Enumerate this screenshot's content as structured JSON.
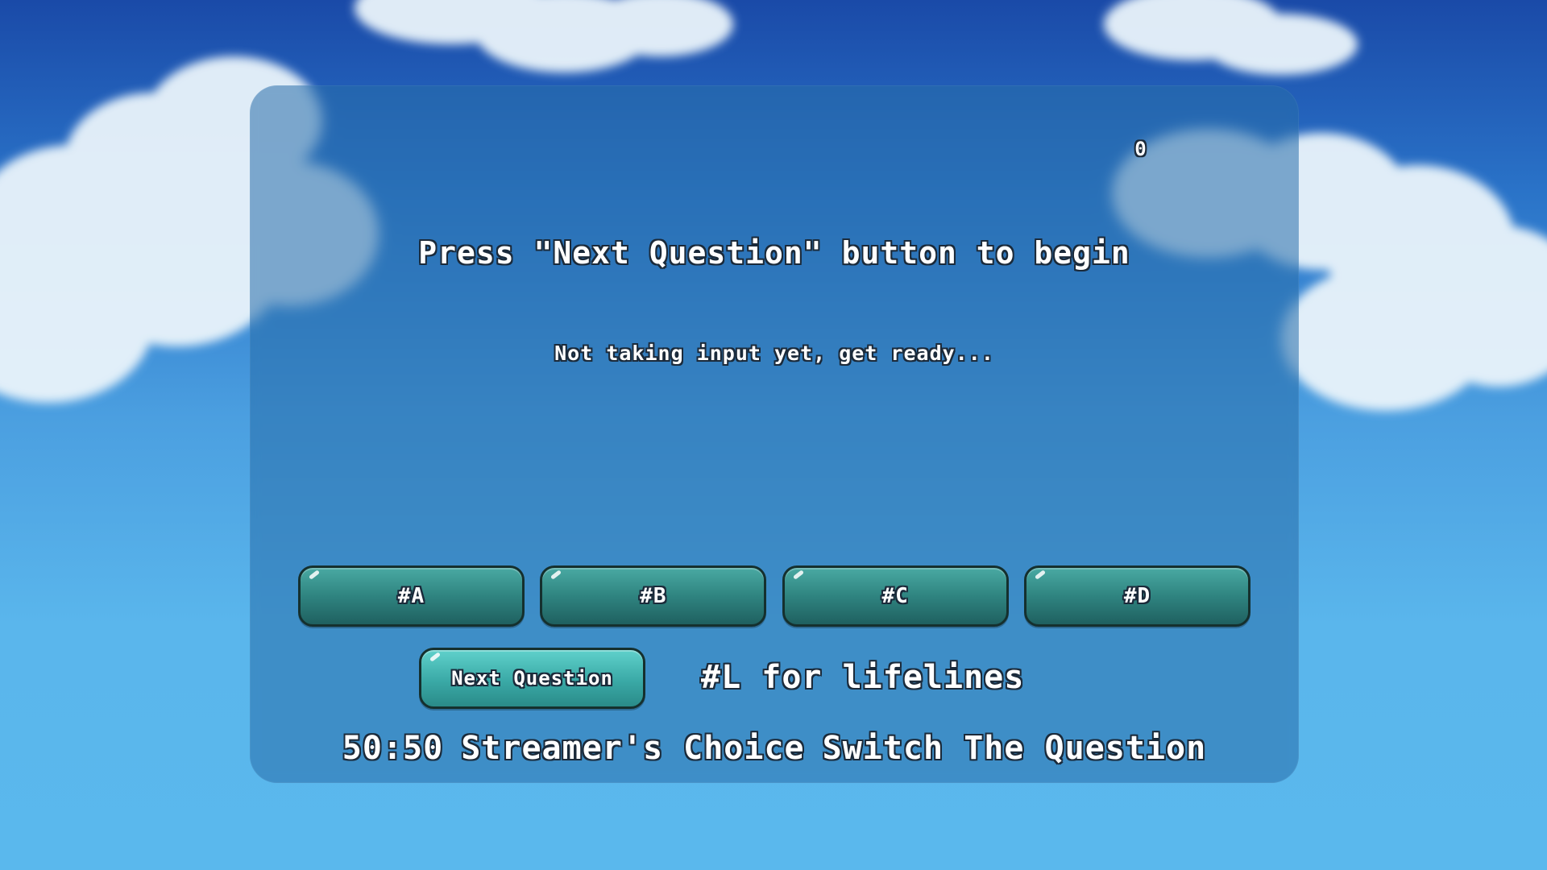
{
  "game": {
    "score": "0",
    "question": "Press \"Next Question\" button to begin",
    "status": "Not taking input yet, get ready...",
    "answers": [
      {
        "label": "#A"
      },
      {
        "label": "#B"
      },
      {
        "label": "#C"
      },
      {
        "label": "#D"
      }
    ],
    "next_button": "Next Question",
    "lifeline_hint": "#L for lifelines",
    "lifelines": [
      "50:50",
      "Streamer's Choice",
      "Switch The Question"
    ]
  },
  "colors": {
    "answer_button": "#2f8480",
    "next_button": "#3aa9a6",
    "panel": "#286eaa"
  }
}
